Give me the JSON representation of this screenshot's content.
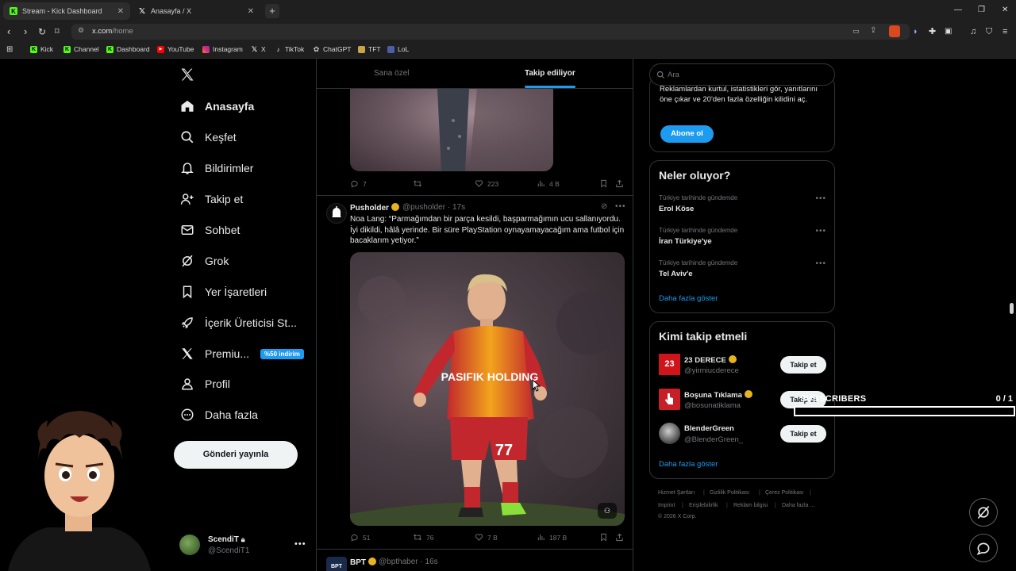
{
  "browser": {
    "tabs": [
      {
        "title": "Stream - Kick Dashboard",
        "icon": "kick-icon",
        "active": true
      },
      {
        "title": "Anasayfa / X",
        "icon": "x-logo-icon",
        "active": false
      }
    ],
    "url_domain": "x.com",
    "url_path": "/home",
    "bookmarks": [
      {
        "label": "Kick",
        "icon": "kick-icon"
      },
      {
        "label": "Channel",
        "icon": "kick-icon"
      },
      {
        "label": "Dashboard",
        "icon": "kick-icon"
      },
      {
        "label": "YouTube",
        "icon": "youtube-icon"
      },
      {
        "label": "Instagram",
        "icon": "instagram-icon"
      },
      {
        "label": "X",
        "icon": "x-logo-icon"
      },
      {
        "label": "TikTok",
        "icon": "tiktok-icon"
      },
      {
        "label": "ChatGPT",
        "icon": "chatgpt-icon"
      },
      {
        "label": "TFT",
        "icon": "tft-icon"
      },
      {
        "label": "LoL",
        "icon": "lol-icon"
      }
    ]
  },
  "nav": {
    "items": [
      {
        "label": "Anasayfa",
        "icon": "home-icon"
      },
      {
        "label": "Keşfet",
        "icon": "search-icon"
      },
      {
        "label": "Bildirimler",
        "icon": "bell-icon"
      },
      {
        "label": "Takip et",
        "icon": "add-user-icon"
      },
      {
        "label": "Sohbet",
        "icon": "mail-icon"
      },
      {
        "label": "Grok",
        "icon": "grok-icon"
      },
      {
        "label": "Yer İşaretleri",
        "icon": "bookmark-icon"
      },
      {
        "label": "İçerik Üreticisi St...",
        "icon": "rocket-icon"
      },
      {
        "label": "Premiu...",
        "icon": "x-logo-icon"
      },
      {
        "label": "Profil",
        "icon": "person-icon"
      },
      {
        "label": "Daha fazla",
        "icon": "more-circle-icon"
      }
    ],
    "premium_badge": "%50 indirim",
    "post_button": "Gönderi yayınla",
    "account": {
      "name": "ScendiT",
      "handle": "@ScendiT1"
    }
  },
  "feed": {
    "tabs": [
      {
        "label": "Sana özel",
        "active": false
      },
      {
        "label": "Takip ediliyor",
        "active": true
      }
    ],
    "prev_post_stats": {
      "replies": "7",
      "likes": "223",
      "views": "4 B"
    },
    "post": {
      "name": "Pusholder",
      "handle": "@pusholder",
      "time": "· 17s",
      "text": "Noa Lang: “Parmağımdan bir parça kesildi, başparmağımın ucu sallanıyordu. İyi dikildi, hâlâ yerinde. Bir süre PlayStation oynayamayacağım ama futbol için bacaklarım yetiyor.”",
      "jersey_text": "PASIFIK HOLDING",
      "jersey_number": "77",
      "stats": {
        "replies": "51",
        "reposts": "76",
        "likes": "7 B",
        "views": "187 B"
      }
    },
    "next_post": {
      "name": "BPT",
      "handle": "@bpthaber",
      "time": "· 16s"
    }
  },
  "sidebar": {
    "search_placeholder": "Ara",
    "premium_card": {
      "text": "Reklamlardan kurtul, istatistikleri gör, yanıtlarını öne çıkar ve 20'den fazla özelliğin kilidini aç.",
      "button": "Abone ol"
    },
    "trends": {
      "title": "Neler oluyor?",
      "items": [
        {
          "context": "Türkiye tarihinde gündemde",
          "name": "Erol Köse"
        },
        {
          "context": "Türkiye tarihinde gündemde",
          "name": "İran Türkiye'ye"
        },
        {
          "context": "Türkiye tarihinde gündemde",
          "name": "Tel Aviv'e"
        }
      ],
      "more": "Daha fazla göster"
    },
    "who_to_follow": {
      "title": "Kimi takip etmeli",
      "items": [
        {
          "name": "23 DERECE",
          "handle": "@yirmiucderece",
          "button": "Takip et",
          "avatar_text": "23"
        },
        {
          "name": "Boşuna Tıklama",
          "handle": "@bosunatiklama",
          "button": "Takip et"
        },
        {
          "name": "BlenderGreen",
          "handle": "@BlenderGreen_",
          "button": "Takip et"
        }
      ],
      "more": "Daha fazla göster"
    },
    "footer": {
      "links": [
        "Hizmet Şartları",
        "Gizlilik Politikası",
        "Çerez Politikası",
        "Imprint",
        "Erişilebilirlik",
        "Reklam bilgisi",
        "Daha fazla ..."
      ],
      "copyright": "© 2026 X Corp."
    }
  },
  "overlay": {
    "subs_label": "SUBSCRIBERS",
    "subs_count": "0 / 1",
    "subs_progress": 0.0
  },
  "colors": {
    "accent": "#1d9bf0",
    "verified": "#e8b321",
    "kick": "#53fc18"
  }
}
